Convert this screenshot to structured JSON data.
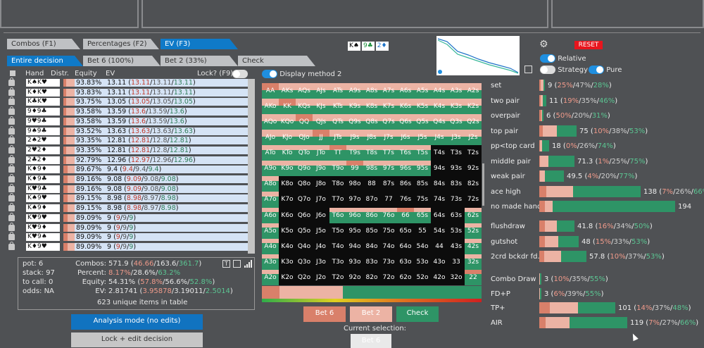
{
  "tabs_row1": [
    {
      "label": "Combos (F1)",
      "active": false
    },
    {
      "label": "Percentages (F2)",
      "active": false
    },
    {
      "label": "EV (F3)",
      "active": true
    }
  ],
  "tabs_row2": [
    {
      "label": "Entire decision",
      "active": true
    },
    {
      "label": "Bet 6 (100%)",
      "active": false
    },
    {
      "label": "Bet 2 (33%)",
      "active": false
    },
    {
      "label": "Check",
      "active": false
    }
  ],
  "board": [
    "K♠",
    "9♣",
    "2♦"
  ],
  "board_colors": [
    "#000000",
    "#1a8f3a",
    "#1f73c8"
  ],
  "table_headers": {
    "hand": "Hand",
    "distr": "Distr.",
    "equity": "Equity",
    "ev": "EV",
    "lock": "Lock? (F9)"
  },
  "display_method_label": "Display method 2",
  "rows": [
    {
      "hand": "K♠K♥",
      "equity": "93.83%",
      "ev": "13.11",
      "ev_a": "13.11",
      "ev_b": "13.11",
      "ev_c": "13.11"
    },
    {
      "hand": "K♦K♥",
      "equity": "93.83%",
      "ev": "13.11",
      "ev_a": "13.11",
      "ev_b": "13.11",
      "ev_c": "13.11"
    },
    {
      "hand": "K♣K♥",
      "equity": "93.75%",
      "ev": "13.05",
      "ev_a": "13.05",
      "ev_b": "13.05",
      "ev_c": "13.05"
    },
    {
      "hand": "9♦9♣",
      "equity": "93.58%",
      "ev": "13.59",
      "ev_a": "13.6",
      "ev_b": "13.59",
      "ev_c": "13.6"
    },
    {
      "hand": "9♥9♣",
      "equity": "93.58%",
      "ev": "13.59",
      "ev_a": "13.6",
      "ev_b": "13.59",
      "ev_c": "13.6"
    },
    {
      "hand": "9♠9♣",
      "equity": "93.52%",
      "ev": "13.63",
      "ev_a": "13.63",
      "ev_b": "13.63",
      "ev_c": "13.63"
    },
    {
      "hand": "2♠2♥",
      "equity": "93.35%",
      "ev": "12.81",
      "ev_a": "12.81",
      "ev_b": "12.8",
      "ev_c": "12.81"
    },
    {
      "hand": "2♥2♦",
      "equity": "93.35%",
      "ev": "12.81",
      "ev_a": "12.81",
      "ev_b": "12.8",
      "ev_c": "12.81"
    },
    {
      "hand": "2♣2♦",
      "equity": "92.79%",
      "ev": "12.96",
      "ev_a": "12.97",
      "ev_b": "12.96",
      "ev_c": "12.96"
    },
    {
      "hand": "K♦9♦",
      "equity": "89.67%",
      "ev": "9.4",
      "ev_a": "9.4",
      "ev_b": "9.4",
      "ev_c": "9.4"
    },
    {
      "hand": "K♦9♣",
      "equity": "89.16%",
      "ev": "9.08",
      "ev_a": "9.09",
      "ev_b": "9.08",
      "ev_c": "9.08"
    },
    {
      "hand": "K♥9♣",
      "equity": "89.16%",
      "ev": "9.08",
      "ev_a": "9.09",
      "ev_b": "9.08",
      "ev_c": "9.08"
    },
    {
      "hand": "K♠9♥",
      "equity": "89.15%",
      "ev": "8.98",
      "ev_a": "8.98",
      "ev_b": "8.97",
      "ev_c": "8.98"
    },
    {
      "hand": "K♠9♦",
      "equity": "89.15%",
      "ev": "8.98",
      "ev_a": "8.98",
      "ev_b": "8.97",
      "ev_c": "8.98"
    },
    {
      "hand": "K♥9♥",
      "equity": "89.09%",
      "ev": "9",
      "ev_a": "9",
      "ev_b": "9",
      "ev_c": "9"
    },
    {
      "hand": "K♥9♦",
      "equity": "89.09%",
      "ev": "9",
      "ev_a": "9",
      "ev_b": "9",
      "ev_c": "9"
    },
    {
      "hand": "K♥9♠",
      "equity": "89.09%",
      "ev": "9",
      "ev_a": "9",
      "ev_b": "9",
      "ev_c": "9"
    },
    {
      "hand": "K♦9♥",
      "equity": "89.09%",
      "ev": "9",
      "ev_a": "9",
      "ev_b": "9",
      "ev_c": "9"
    }
  ],
  "summary": {
    "pot": "pot: 6",
    "stack": "stack: 97",
    "to_call": "to call: 0",
    "odds": "odds: NA",
    "combos_label": "Combos:",
    "combos_total": "571.9",
    "combos_a": "46.66",
    "combos_b": "163.6",
    "combos_c": "361.7",
    "percent_label": "Percent:",
    "percent_a": "8.17%",
    "percent_b": "28.6%",
    "percent_c": "63.2%",
    "equity_label": "Equity:",
    "equity_total": "54.31%",
    "equity_a": "57.8%",
    "equity_b": "56.6%",
    "equity_c": "52.8%",
    "ev_label": "EV:",
    "ev_total": "2.81741",
    "ev_a": "3.95878",
    "ev_b": "3.19011",
    "ev_c": "2.5014",
    "unique": "623 unique items in table"
  },
  "analysis_button": "Analysis mode (no edits)",
  "lock_button": "Lock + edit decision",
  "action_buttons": [
    "Bet 6",
    "Bet 2",
    "Check"
  ],
  "current_selection_label": "Current selection:",
  "current_selection_value": "Bet 6",
  "reset_button": "RESET",
  "toggles": {
    "relative": "Relative",
    "strategy": "Strategy",
    "pure": "Pure"
  },
  "grid": [
    [
      "AA",
      "AKs",
      "AQs",
      "AJs",
      "ATs",
      "A9s",
      "A8s",
      "A7s",
      "A6s",
      "A5s",
      "A4s",
      "A3s",
      "A2s"
    ],
    [
      "AKo",
      "KK",
      "KQs",
      "KJs",
      "KTs",
      "K9s",
      "K8s",
      "K7s",
      "K6s",
      "K5s",
      "K4s",
      "K3s",
      "K2s"
    ],
    [
      "AQo",
      "KQo",
      "QQ",
      "QJs",
      "QTs",
      "Q9s",
      "Q8s",
      "Q7s",
      "Q6s",
      "Q5s",
      "Q4s",
      "Q3s",
      "Q2s"
    ],
    [
      "AJo",
      "KJo",
      "QJo",
      "JJ",
      "JTs",
      "J9s",
      "J8s",
      "J7s",
      "J6s",
      "J5s",
      "J4s",
      "J3s",
      "J2s"
    ],
    [
      "ATo",
      "KTo",
      "QTo",
      "JTo",
      "TT",
      "T9s",
      "T8s",
      "T7s",
      "T6s",
      "T5s",
      "T4s",
      "T3s",
      "T2s"
    ],
    [
      "A9o",
      "K9o",
      "Q9o",
      "J9o",
      "T9o",
      "99",
      "98s",
      "97s",
      "96s",
      "95s",
      "94s",
      "93s",
      "92s"
    ],
    [
      "A8o",
      "K8o",
      "Q8o",
      "J8o",
      "T8o",
      "98o",
      "88",
      "87s",
      "86s",
      "85s",
      "84s",
      "83s",
      "82s"
    ],
    [
      "A7o",
      "K7o",
      "Q7o",
      "J7o",
      "T7o",
      "97o",
      "87o",
      "77",
      "76s",
      "75s",
      "74s",
      "73s",
      "72s"
    ],
    [
      "A6o",
      "K6o",
      "Q6o",
      "J6o",
      "T6o",
      "96o",
      "86o",
      "76o",
      "66",
      "65s",
      "64s",
      "63s",
      "62s"
    ],
    [
      "A5o",
      "K5o",
      "Q5o",
      "J5o",
      "T5o",
      "95o",
      "85o",
      "75o",
      "65o",
      "55",
      "54s",
      "53s",
      "52s"
    ],
    [
      "A4o",
      "K4o",
      "Q4o",
      "J4o",
      "T4o",
      "94o",
      "84o",
      "74o",
      "64o",
      "54o",
      "44",
      "43s",
      "42s"
    ],
    [
      "A3o",
      "K3o",
      "Q3o",
      "J3o",
      "T3o",
      "93o",
      "83o",
      "73o",
      "63o",
      "53o",
      "43o",
      "33",
      "32s"
    ],
    [
      "A2o",
      "K2o",
      "Q2o",
      "J2o",
      "T2o",
      "92o",
      "82o",
      "72o",
      "62o",
      "52o",
      "42o",
      "32o",
      "22"
    ]
  ],
  "stats_made": [
    {
      "label": "set",
      "val": "9",
      "a": "25%",
      "b": "47%",
      "c": "28%",
      "w": 8
    },
    {
      "label": "two pair",
      "val": "11",
      "a": "19%",
      "b": "35%",
      "c": "46%",
      "w": 10
    },
    {
      "label": "overpair",
      "val": "6",
      "a": "50%",
      "b": "20%",
      "c": "31%",
      "w": 6
    },
    {
      "label": "top pair",
      "val": "75",
      "a": "10%",
      "b": "38%",
      "c": "53%",
      "w": 53
    },
    {
      "label": "pp<top card",
      "val": "18",
      "a": "0%",
      "b": "26%",
      "c": "74%",
      "w": 14
    },
    {
      "label": "middle pair",
      "val": "71.3",
      "a": "1%",
      "b": "25%",
      "c": "75%",
      "w": 50
    },
    {
      "label": "weak pair",
      "val": "49.5",
      "a": "4%",
      "b": "20%",
      "c": "77%",
      "w": 35
    },
    {
      "label": "ace high",
      "val": "138",
      "a": "7%",
      "b": "26%",
      "c": "66%",
      "w": 144
    },
    {
      "label": "no made hand",
      "val": "194",
      "a": "",
      "b": "",
      "c": "",
      "w": 193
    }
  ],
  "stats_draws": [
    {
      "label": "flushdraw",
      "val": "41.8",
      "a": "16%",
      "b": "34%",
      "c": "50%",
      "w": 50
    },
    {
      "label": "gutshot",
      "val": "48",
      "a": "15%",
      "b": "33%",
      "c": "53%",
      "w": 56
    },
    {
      "label": "2crd bckdr fd.",
      "val": "57.8",
      "a": "10%",
      "b": "37%",
      "c": "53%",
      "w": 67
    }
  ],
  "stats_combo": [
    {
      "label": "Combo Draw",
      "val": "3",
      "a": "10%",
      "b": "35%",
      "c": "55%",
      "w": 3
    },
    {
      "label": "FD+P",
      "val": "3",
      "a": "6%",
      "b": "39%",
      "c": "55%",
      "w": 3
    },
    {
      "label": "TP+",
      "val": "101",
      "a": "14%",
      "b": "37%",
      "c": "48%",
      "w": 108
    },
    {
      "label": "AIR",
      "val": "119",
      "a": "7%",
      "b": "27%",
      "c": "66%",
      "w": 125
    }
  ],
  "colors": {
    "bet_big": "#d9806a",
    "bet_small": "#ecb3a4",
    "check": "#2e9466",
    "tab_active": "#0f7ac8",
    "reset": "#e8151d"
  }
}
